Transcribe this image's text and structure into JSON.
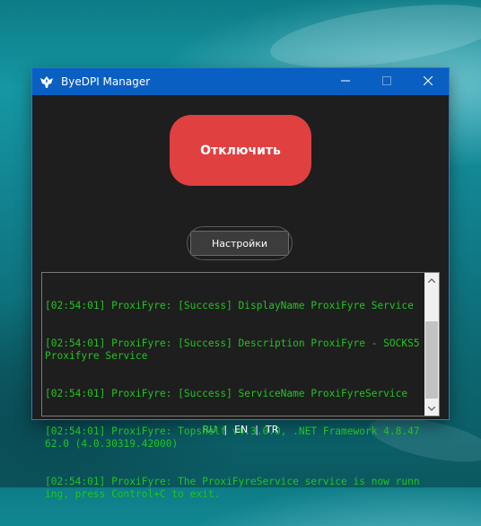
{
  "window": {
    "title": "ByeDPI Manager"
  },
  "main": {
    "disconnect_label": "Отключить",
    "settings_label": "Настройки"
  },
  "log": {
    "lines": [
      "[02:54:01] ProxiFyre: [Success] DisplayName ProxiFyre Service",
      "[02:54:01] ProxiFyre: [Success] Description ProxiFyre - SOCKS5 Proxifyre Service",
      "[02:54:01] ProxiFyre: [Success] ServiceName ProxiFyreService",
      "[02:54:01] ProxiFyre: Topshelf v4.3.0.0, .NET Framework 4.8.4762.0 (4.0.30319.42000)",
      "[02:54:01] ProxiFyre: The ProxiFyreService service is now running, press Control+C to exit."
    ]
  },
  "languages": {
    "ru": "RU",
    "en": "EN",
    "tr": "TR",
    "separator": "|",
    "active": "RU"
  },
  "colors": {
    "titlebar": "#0a5fc2",
    "window_bg": "#1e1e1e",
    "disconnect_button": "#e04040",
    "log_text": "#22c322",
    "active_language": "#4cd04c"
  },
  "icons": {
    "app": "bird-logo-icon",
    "minimize": "minimize-icon",
    "maximize": "maximize-icon",
    "close": "close-icon"
  }
}
